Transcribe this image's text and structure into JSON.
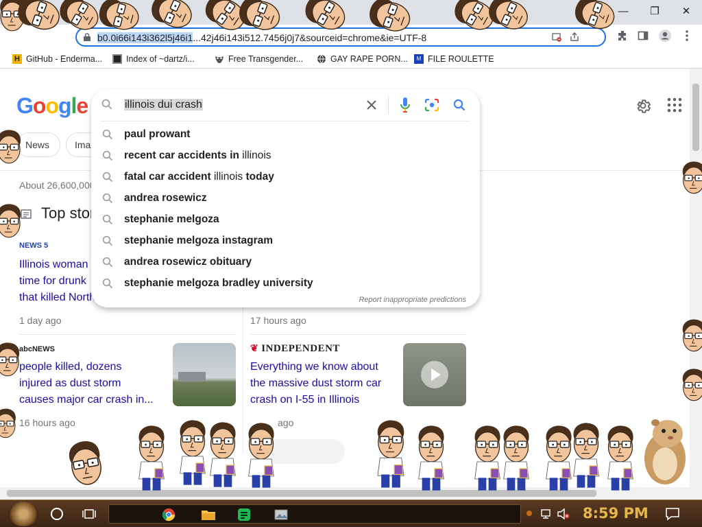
{
  "browser": {
    "url_selected": "b0.0i66i143i362l5j46i1",
    "url_rest": "...42j46i143i512.7456j0j7&sourceid=chrome&ie=UTF-8",
    "bookmarks": [
      {
        "label": "GitHub - Enderma...",
        "icon": "h-logo-icon"
      },
      {
        "label": "Index of ~dartz/i...",
        "icon": "pixel-icon"
      },
      {
        "label": "Free Transgender...",
        "icon": "mask-icon"
      },
      {
        "label": "GAY RAPE PORN...",
        "icon": "globe-icon"
      },
      {
        "label": "FILE ROULETTE",
        "icon": "box-icon"
      }
    ],
    "window_buttons": {
      "minimize": "—",
      "restore": "❐",
      "close": "✕"
    }
  },
  "search": {
    "query": "illinois dui crash",
    "suggestions": [
      {
        "bold": "paul prowant",
        "normal": "",
        "bold2": ""
      },
      {
        "bold": "recent car accidents in",
        "normal": " illinois",
        "bold2": ""
      },
      {
        "bold": "fatal car accident",
        "normal": " illinois ",
        "bold2": "today"
      },
      {
        "bold": "andrea rosewicz",
        "normal": "",
        "bold2": ""
      },
      {
        "bold": "stephanie melgoza",
        "normal": "",
        "bold2": ""
      },
      {
        "bold": "stephanie melgoza instagram",
        "normal": "",
        "bold2": ""
      },
      {
        "bold": "andrea rosewicz obituary",
        "normal": "",
        "bold2": ""
      },
      {
        "bold": "stephanie melgoza bradley university",
        "normal": "",
        "bold2": ""
      }
    ],
    "report_link": "Report inappropriate predictions"
  },
  "page": {
    "logo": [
      "G",
      "o",
      "o",
      "g",
      "l",
      "e"
    ],
    "logo_colors": [
      "#4285f4",
      "#ea4335",
      "#fbbc05",
      "#4285f4",
      "#34a853",
      "#ea4335"
    ],
    "chips": [
      "News",
      "Ima"
    ],
    "result_stats": "About 26,600,000",
    "top_stories": "Top stor",
    "cards": [
      {
        "source": "NEWS 5",
        "title_lines": [
          "Illinois woman",
          "time for drunk",
          "that killed North"
        ],
        "time": "1 day ago"
      },
      {
        "source": "",
        "title_lines": [],
        "time": "17 hours ago"
      },
      {
        "source": "abcNEWS",
        "title_lines": [
          "people killed, dozens",
          "injured as dust storm",
          "causes major car crash in..."
        ],
        "time": "16 hours ago"
      },
      {
        "source": "INDEPENDENT",
        "title_lines": [
          "Everything we know about",
          "the massive dust storm car",
          "crash on I-55 in Illinois"
        ],
        "time": "ago"
      }
    ]
  },
  "taskbar": {
    "clock": "8:59 PM"
  },
  "colors": {
    "accent": "#1a73e8",
    "link": "#1a0dab",
    "taskbar": "#3b2414",
    "clock": "#e6b64b"
  }
}
